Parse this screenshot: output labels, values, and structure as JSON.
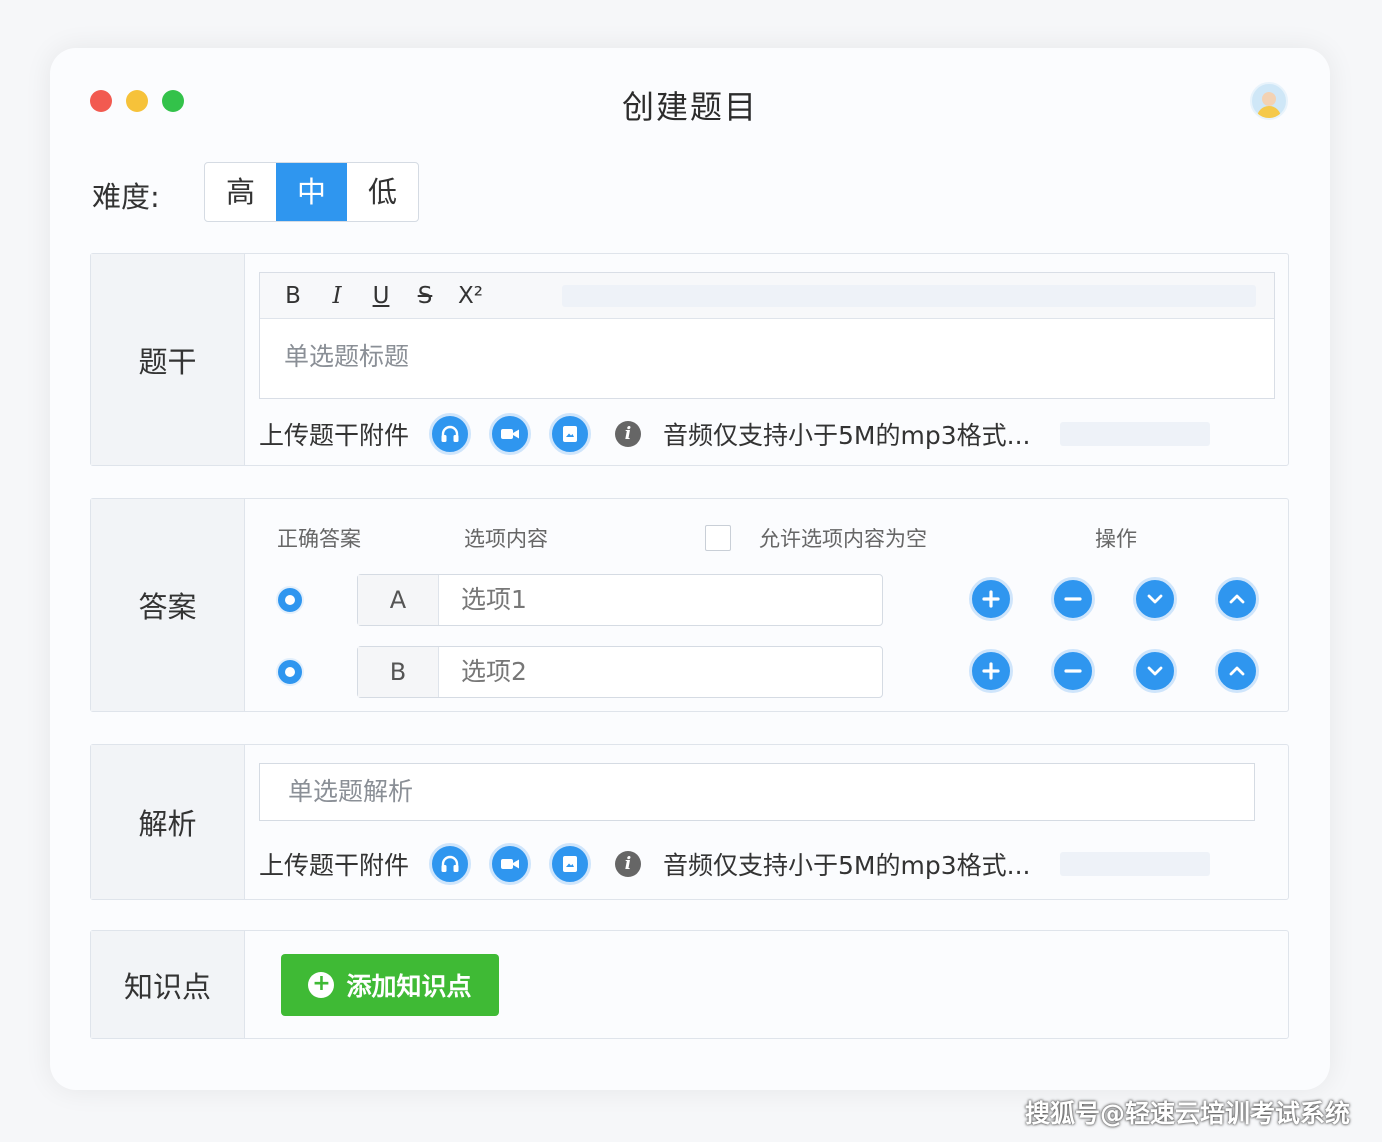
{
  "window": {
    "title": "创建题目"
  },
  "difficulty": {
    "label": "难度:",
    "options": [
      "高",
      "中",
      "低"
    ],
    "selected": "中"
  },
  "stem": {
    "label": "题干",
    "toolbar": [
      "B",
      "I",
      "U",
      "S",
      "X²"
    ],
    "placeholder": "单选题标题",
    "upload_label": "上传题干附件",
    "hint": "音频仅支持小于5M的mp3格式..."
  },
  "answer": {
    "label": "答案",
    "headers": {
      "correct": "正确答案",
      "content": "选项内容",
      "allow_empty": "允许选项内容为空",
      "actions": "操作"
    },
    "options": [
      {
        "letter": "A",
        "text": "选项1"
      },
      {
        "letter": "B",
        "text": "选项2"
      }
    ]
  },
  "analysis": {
    "label": "解析",
    "placeholder": "单选题解析",
    "upload_label": "上传题干附件",
    "hint": "音频仅支持小于5M的mp3格式..."
  },
  "knowledge": {
    "label": "知识点",
    "add_button": "添加知识点"
  },
  "watermark": "搜狐号@轻速云培训考试系统",
  "colors": {
    "accent": "#2f96ef",
    "success": "#3fba35"
  }
}
